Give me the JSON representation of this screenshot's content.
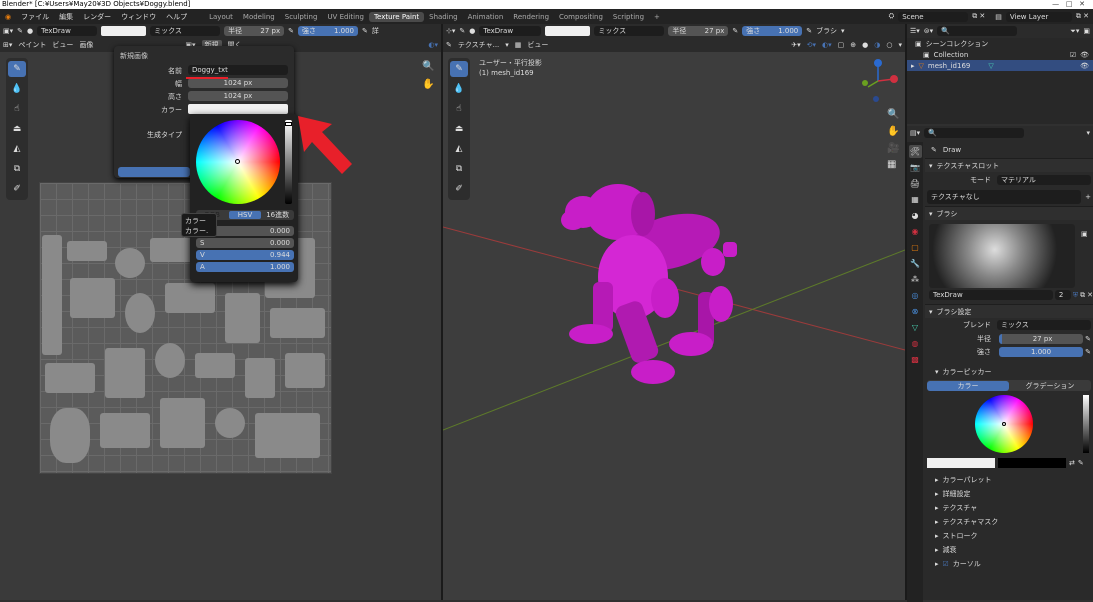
{
  "window": {
    "title": "Blender* [C:¥Users¥May20¥3D Objects¥Doggy.blend]"
  },
  "menu": {
    "items": [
      "ファイル",
      "編集",
      "レンダー",
      "ウィンドウ",
      "ヘルプ"
    ],
    "workspaces": [
      "Layout",
      "Modeling",
      "Sculpting",
      "UV Editing",
      "Texture Paint",
      "Shading",
      "Animation",
      "Rendering",
      "Compositing",
      "Scripting"
    ],
    "active_workspace": "Texture Paint",
    "scene": "Scene",
    "view_layer": "View Layer"
  },
  "left_header": {
    "brush": "TexDraw",
    "blend": "ミックス",
    "radius_label": "半径",
    "radius_value": "27 px",
    "strength_label": "強さ",
    "strength_value": "1.000",
    "extra": "詳"
  },
  "left_sub": {
    "mode": "ペイント",
    "view": "ビュー",
    "image": "画像",
    "new": "新規",
    "open": "開く"
  },
  "new_image_dialog": {
    "title": "新規画像",
    "name_label": "名前",
    "name_value": "Doggy_txt",
    "width_label": "幅",
    "width_value": "1024 px",
    "height_label": "高さ",
    "height_value": "1024 px",
    "color_label": "カラー",
    "generated_label": "生成タイプ"
  },
  "color_picker": {
    "tabs": [
      "RGB",
      "HSV",
      "16進数"
    ],
    "active_tab": "HSV",
    "h_label": "H",
    "h_value": "0.000",
    "s_label": "S",
    "s_value": "0.000",
    "v_label": "V",
    "v_value": "0.944",
    "a_label": "A",
    "a_value": "1.000",
    "tooltip_line1": "カラー",
    "tooltip_line2": "カラー."
  },
  "viewport": {
    "brush": "TexDraw",
    "blend": "ミックス",
    "radius_label": "半径",
    "radius_value": "27 px",
    "strength_label": "強さ",
    "strength_value": "1.000",
    "brush_menu": "ブラシ",
    "mode": "テクスチャ...",
    "view": "ビュー",
    "info_line1": "ユーザー・平行投影",
    "info_line2": "(1) mesh_id169"
  },
  "outliner": {
    "scene_collection": "シーンコレクション",
    "collection": "Collection",
    "object": "mesh_id169"
  },
  "properties": {
    "tool_name": "Draw",
    "texture_slot_header": "テクスチャスロット",
    "mode_label": "モード",
    "mode_value": "マテリアル",
    "no_texture": "テクスチャなし",
    "brush_header": "ブラシ",
    "brush_name": "TexDraw",
    "brush_users": "2",
    "brush_settings_header": "ブラシ設定",
    "blend_label": "ブレンド",
    "blend_value": "ミックス",
    "radius_label": "半径",
    "radius_value": "27 px",
    "strength_label": "強さ",
    "strength_value": "1.000",
    "color_picker_header": "カラーピッカー",
    "color_tab": "カラー",
    "gradient_tab": "グラデーション",
    "sub_sections": [
      "カラーパレット",
      "詳細設定",
      "テクスチャ",
      "テクスチャマスク",
      "ストローク",
      "減衰",
      "カーソル"
    ]
  },
  "colors": {
    "accent": "#4772b3",
    "model": "#c81ec8",
    "arrow": "#e8202a"
  }
}
